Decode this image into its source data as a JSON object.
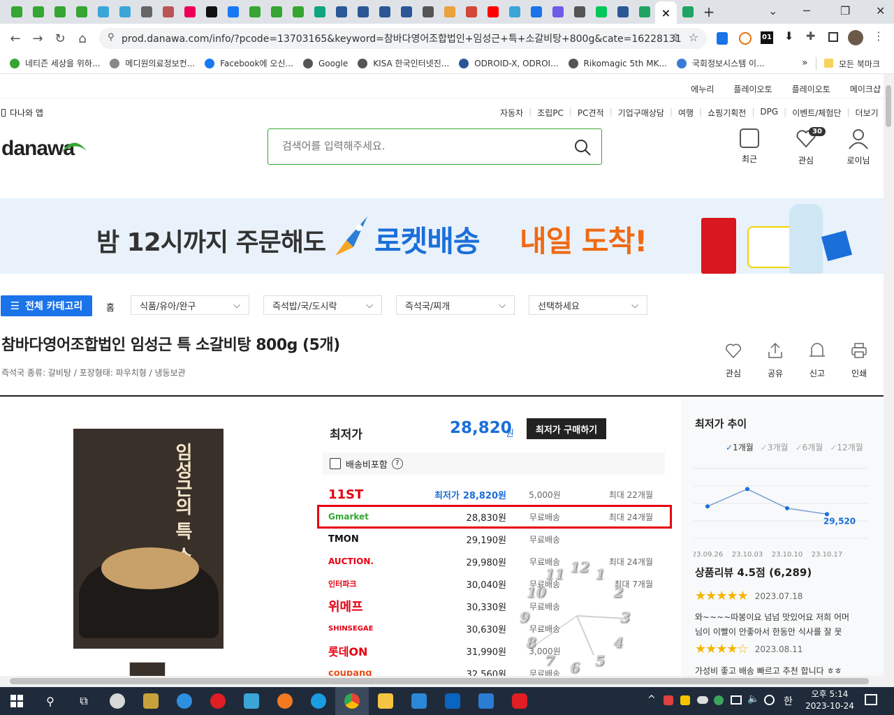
{
  "browser": {
    "active_tab_close": "×",
    "new_tab": "+",
    "url": "prod.danawa.com/info/?pcode=13703165&keyword=참바다영어조합법인+임성근+특+소갈비탕+800g&cate=16228131",
    "bookmarks": [
      "네티즌 세상을 위하...",
      "메디원의료정보컨...",
      "Facebook에 오신...",
      "Google",
      "KISA 한국인터넷진...",
      "ODROID-X, ODROI...",
      "Rikomagic 5th MK...",
      "국회정보시스템 이..."
    ],
    "more_bookmarks": "»",
    "all_bookmarks": "모든 북마크",
    "ext_badge": "01"
  },
  "site": {
    "top_links": [
      "에누리",
      "플레이오토",
      "플레이오토",
      "메이크샵"
    ],
    "app_link": "다나와 앱",
    "util_links": [
      "자동차",
      "조립PC",
      "PC견적",
      "기업구매상담",
      "여행",
      "쇼핑기획전",
      "DPG",
      "이벤트/체험단",
      "더보기"
    ],
    "logo": "danawa",
    "search_placeholder": "검색어를 입력해주세요.",
    "header_icons": {
      "recent": "최근",
      "wish": "관심",
      "wish_count": "30",
      "login": "로이님"
    },
    "banner": {
      "text1": "밤 12시까지 주문해도",
      "text2": "로켓배송",
      "text3": "내일 도착!"
    },
    "all_category": "전체 카테고리",
    "breadcrumb": {
      "home": "홈",
      "cat1": "식품/유아/완구",
      "cat2": "즉석밥/국/도시락",
      "cat3": "즉석국/찌개",
      "cat4": "선택하세요"
    }
  },
  "product": {
    "title": "참바다영어조합법인 임성근 특 소갈비탕 800g (5개)",
    "specs": "즉석국 종류: 갈비탕 / 포장형태: 파우치형 / 냉동보관",
    "actions": [
      "관심",
      "공유",
      "신고",
      "인쇄"
    ],
    "image_text": "임성근의 특 소갈비탕",
    "lowest_label": "최저가",
    "lowest_price": "28,820",
    "won": "원",
    "buy_button": "최저가 구매하기",
    "include_shipping": "배송비포함",
    "help": "?",
    "shops": [
      {
        "shop": "11ST",
        "label": "최저가",
        "price": "28,820원",
        "ship": "5,000원",
        "inst": "최대 22개월"
      },
      {
        "shop": "Gmarket",
        "label": "",
        "price": "28,830원",
        "ship": "무료배송",
        "inst": "최대 24개월"
      },
      {
        "shop": "TMON",
        "label": "",
        "price": "29,190원",
        "ship": "무료배송",
        "inst": ""
      },
      {
        "shop": "AUCTION.",
        "label": "",
        "price": "29,980원",
        "ship": "무료배송",
        "inst": "최대 24개월"
      },
      {
        "shop": "인터파크",
        "label": "",
        "price": "30,040원",
        "ship": "무료배송",
        "inst": "최대 7개월"
      },
      {
        "shop": "위메프",
        "label": "",
        "price": "30,330원",
        "ship": "무료배송",
        "inst": ""
      },
      {
        "shop": "SHINSEGAE",
        "label": "",
        "price": "30,630원",
        "ship": "무료배송",
        "inst": ""
      },
      {
        "shop": "롯데ON",
        "label": "",
        "price": "31,990원",
        "ship": "3,000원",
        "inst": ""
      },
      {
        "shop": "coupang",
        "label": "",
        "price": "32,560원",
        "ship": "무료배송",
        "inst": ""
      }
    ]
  },
  "trend": {
    "title": "최저가 추이",
    "periods": [
      "1개월",
      "3개월",
      "6개월",
      "12개월"
    ],
    "dates": [
      "23.09.26",
      "23.10.03",
      "23.10.10",
      "23.10.17"
    ],
    "latest": "29,520"
  },
  "chart_data": {
    "type": "line",
    "x": [
      "23.09.26",
      "23.10.03",
      "23.10.10",
      "23.10.17"
    ],
    "values": [
      29650,
      29940,
      29620,
      29520
    ]
  },
  "review": {
    "title": "상품리뷰",
    "score": "4.5",
    "score_unit": "점",
    "count": "(6,289)",
    "items": [
      {
        "stars": "★★★★★",
        "date": "2023.07.18",
        "text1": "와~~~~따봉이요 넘넘 맛있어요 저희 어머",
        "text2": "님이 이빨이 안좋아서 한동안 식사를 잘 못"
      },
      {
        "stars": "★★★★☆",
        "date": "2023.08.11",
        "text1": "가성비 좋고 배송 빠르고 추천 합니다 ㅎㅎ",
        "text2": ""
      }
    ]
  },
  "clock_numbers": [
    "12",
    "1",
    "2",
    "3",
    "4",
    "5",
    "6",
    "7",
    "8",
    "9",
    "10",
    "11"
  ],
  "taskbar": {
    "ampm_time": "오후 5:14",
    "date": "2023-10-24",
    "ime": "한",
    "tray_arrow": "^"
  },
  "colors": {
    "accent_blue": "#1a6fd9",
    "danawa_green": "#36a532",
    "highlight_red": "#e60012",
    "banner_orange": "#f06a14"
  }
}
